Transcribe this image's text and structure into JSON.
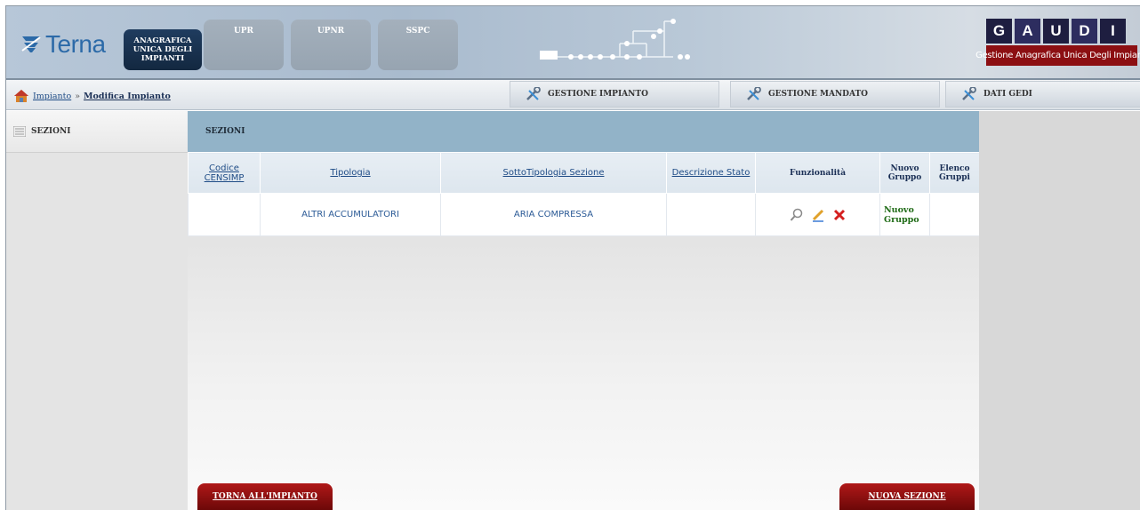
{
  "header": {
    "brand_word": "Terna",
    "app_badge": "ANAGRAFICA UNICA DEGLI IMPIANTI",
    "top_tabs": [
      "UPR",
      "UPNR",
      "SSPC"
    ],
    "gaudi_letters": [
      "G",
      "A",
      "U",
      "D",
      "I"
    ],
    "gaudi_subtitle": "Gestione Anagrafica Unica Degli Impianti"
  },
  "breadcrumb": {
    "parent": "Impianto",
    "separator": "»",
    "current": "Modifica Impianto"
  },
  "nav_tabs": [
    {
      "label": "GESTIONE IMPIANTO",
      "icon": "tools-icon"
    },
    {
      "label": "GESTIONE MANDATO",
      "icon": "tools-icon"
    },
    {
      "label": "DATI GEDI",
      "icon": "tools-icon"
    }
  ],
  "sidebar": {
    "title": "SEZIONI",
    "icon": "list-icon"
  },
  "sezioni": {
    "title": "SEZIONI",
    "columns": [
      "Codice CENSIMP",
      "Tipologia",
      "SottoTipologia Sezione",
      "Descrizione Stato",
      "Funzionalità",
      "Nuovo Gruppo",
      "Elenco Gruppi"
    ],
    "rows": [
      {
        "codice": "",
        "tipologia": "ALTRI ACCUMULATORI",
        "sottotipologia": "ARIA COMPRESSA",
        "stato": "",
        "functions": [
          "view-icon",
          "edit-icon",
          "delete-icon"
        ],
        "nuovo_gruppo": "Nuovo Gruppo",
        "elenco_gruppi": ""
      }
    ]
  },
  "buttons": {
    "back": "TORNA ALL'IMPIANTO",
    "new_section": "NUOVA SEZIONE"
  },
  "colors": {
    "header_blue": "#a9bbce",
    "badge_navy": "#1f3c5f",
    "table_title": "#92b3c8",
    "action_red": "#8c0f12",
    "link_blue": "#1f4c86",
    "group_green": "#1f6b16"
  }
}
